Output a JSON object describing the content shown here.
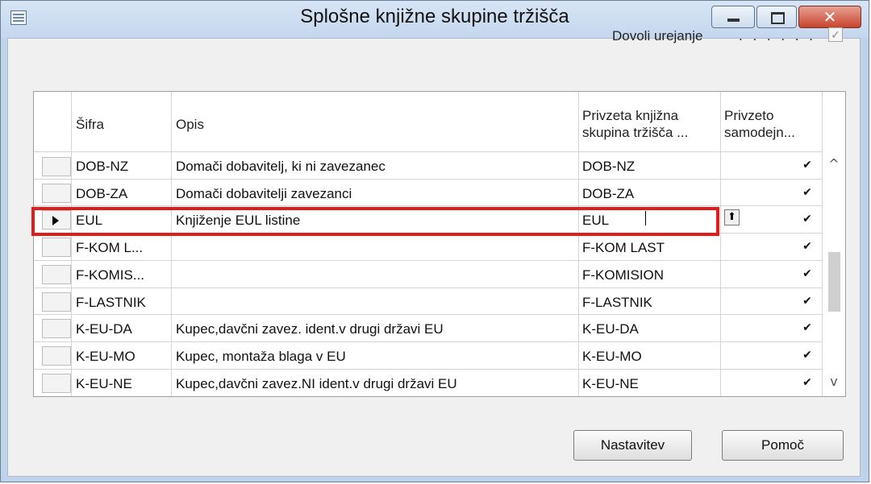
{
  "window": {
    "title": "Splošne knjižne skupine tržišča",
    "icons": {
      "app": "table-icon",
      "minimize": "minimize-icon",
      "maximize": "maximize-icon",
      "close": "close-icon"
    },
    "close_glyph": "✕"
  },
  "allow_edit": {
    "label": "Dovoli urejanje",
    "dots": ". . . . . .",
    "checked": true,
    "check_glyph": "✓"
  },
  "table": {
    "columns": [
      {
        "label": "Šifra"
      },
      {
        "label": "Opis"
      },
      {
        "label": "Privzeta knjižna skupina tržišča ..."
      },
      {
        "label": "Privzeto samodejn..."
      }
    ],
    "header_lines": {
      "col3_line1": "Privzeta knjižna",
      "col3_line2": "skupina tržišča ...",
      "col4_line1": "Privzeto",
      "col4_line2": "samodejn..."
    },
    "rows": [
      {
        "code": "DOB-NZ",
        "description": "Domači dobavitelj, ki ni zavezanec",
        "default_group": "DOB-NZ",
        "auto": "✔"
      },
      {
        "code": "DOB-ZA",
        "description": "Domači dobavitelji zavezanci",
        "default_group": "DOB-ZA",
        "auto": "✔"
      },
      {
        "code": "EUL",
        "description": "Knjiženje EUL listine",
        "default_group": "EUL",
        "auto": "✔"
      },
      {
        "code": "F-KOM L...",
        "description": "",
        "default_group": "F-KOM LAST",
        "auto": "✔"
      },
      {
        "code": "F-KOMIS...",
        "description": "",
        "default_group": "F-KOMISION",
        "auto": "✔"
      },
      {
        "code": "F-LASTNIK",
        "description": "",
        "default_group": "F-LASTNIK",
        "auto": "✔"
      },
      {
        "code": "K-EU-DA",
        "description": "Kupec,davčni zavez. ident.v drugi državi EU",
        "default_group": "K-EU-DA",
        "auto": "✔"
      },
      {
        "code": "K-EU-MO",
        "description": "Kupec, montaža blaga v EU",
        "default_group": "K-EU-MO",
        "auto": "✔"
      },
      {
        "code": "K-EU-NE",
        "description": "Kupec,davčni zavez.NI ident.v drugi državi EU",
        "default_group": "K-EU-NE",
        "auto": "✔"
      }
    ],
    "selected_row": "EUL",
    "lookup_glyph": "⬆",
    "scroll_up": "^",
    "scroll_down": "v"
  },
  "buttons": {
    "setup": "Nastavitev",
    "help": "Pomoč"
  },
  "colors": {
    "highlight": "#e21b1b",
    "titlebar": "#c4d7ee",
    "close": "#c8442e"
  }
}
